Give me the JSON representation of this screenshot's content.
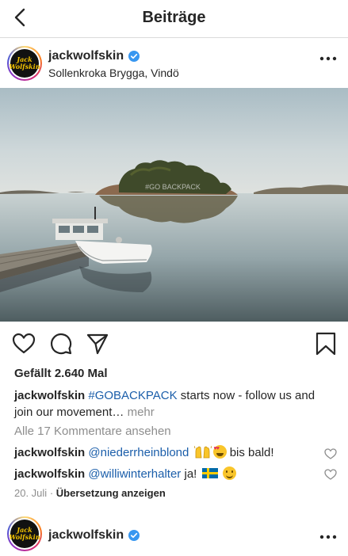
{
  "header": {
    "title": "Beiträge",
    "back_icon": "chevron-left-icon"
  },
  "post": {
    "username": "jackwolfskin",
    "avatar_text_line1": "Jack",
    "avatar_text_line2": "Wolfskin",
    "location": "Sollenkroka Brygga, Vindö",
    "photo_watermark": "#GO BACKPACK",
    "likes": "Gefällt 2.640 Mal",
    "caption": {
      "username": "jackwolfskin",
      "hashtag": "#GOBACKPACK",
      "text": " starts now - follow us and join our movement…",
      "more": "mehr"
    },
    "view_comments": "Alle 17 Kommentare ansehen",
    "comments": [
      {
        "username": "jackwolfskin",
        "mention": "@niederrheinblond",
        "text": " bis bald!"
      },
      {
        "username": "jackwolfskin",
        "mention": "@williwinterhalter",
        "text": " ja!"
      }
    ],
    "date": "20. Juli",
    "separator": "·",
    "translate": "Übersetzung anzeigen"
  },
  "next_post": {
    "username": "jackwolfskin"
  },
  "colors": {
    "accent_link": "#1b5eaa",
    "verified_blue": "#3897f0",
    "muted": "#8e8e8e",
    "text": "#262626"
  }
}
